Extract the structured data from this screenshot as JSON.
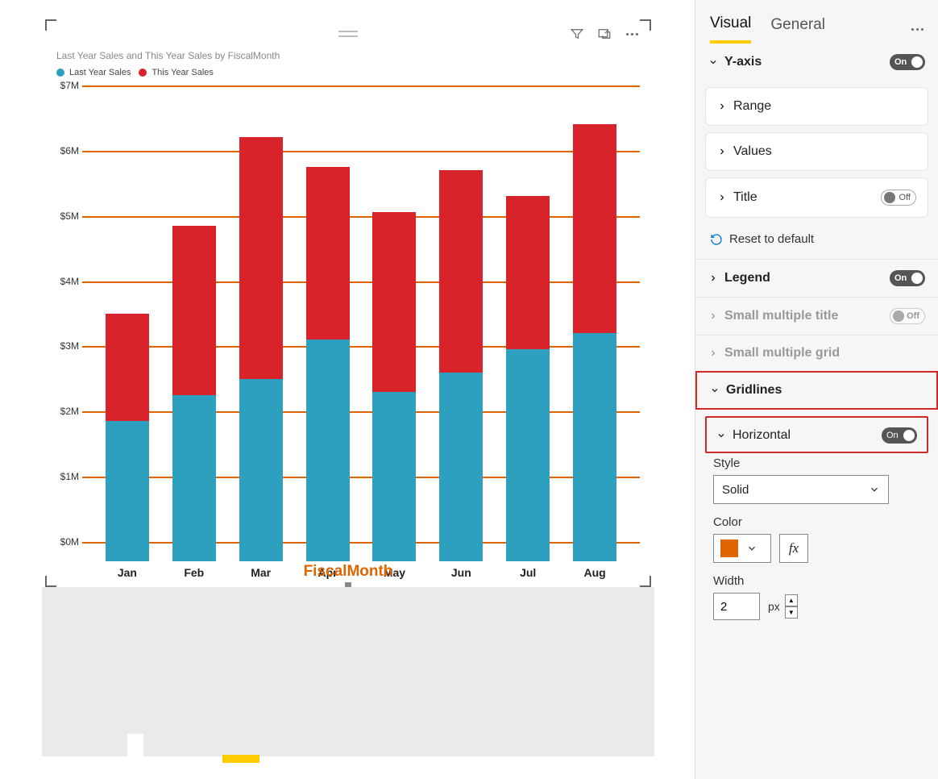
{
  "tabs": {
    "visual": "Visual",
    "general": "General"
  },
  "yaxis": {
    "label": "Y-axis",
    "toggle": "On",
    "range": "Range",
    "values": "Values",
    "title": "Title",
    "title_toggle": "Off",
    "reset": "Reset to default"
  },
  "legend": {
    "label": "Legend",
    "toggle": "On"
  },
  "small_multiple_title": {
    "label": "Small multiple title",
    "toggle": "Off"
  },
  "small_multiple_grid": {
    "label": "Small multiple grid"
  },
  "gridlines": {
    "label": "Gridlines"
  },
  "horizontal": {
    "label": "Horizontal",
    "toggle": "On",
    "style_label": "Style",
    "style_value": "Solid",
    "color_label": "Color",
    "color_value": "#e06500",
    "width_label": "Width",
    "width_value": "2",
    "width_unit": "px"
  },
  "chart": {
    "title": "Last Year Sales and This Year Sales by FiscalMonth",
    "legend_items": [
      {
        "label": "Last Year Sales",
        "color": "#2ea0bf"
      },
      {
        "label": "This Year Sales",
        "color": "#d8232a"
      }
    ],
    "x_axis_title": "FiscalMonth"
  },
  "chart_data": {
    "type": "bar",
    "stacked": true,
    "title": "Last Year Sales and This Year Sales by FiscalMonth",
    "xlabel": "FiscalMonth",
    "ylabel": "",
    "ylim": [
      0,
      7
    ],
    "yticks": [
      "$0M",
      "$1M",
      "$2M",
      "$3M",
      "$4M",
      "$5M",
      "$6M",
      "$7M"
    ],
    "categories": [
      "Jan",
      "Feb",
      "Mar",
      "Apr",
      "May",
      "Jun",
      "Jul",
      "Aug"
    ],
    "series": [
      {
        "name": "Last Year Sales",
        "color": "#2ea0bf",
        "values": [
          2.15,
          2.55,
          2.8,
          3.4,
          2.6,
          2.9,
          3.25,
          3.5
        ]
      },
      {
        "name": "This Year Sales",
        "color": "#d8232a",
        "values": [
          1.65,
          2.6,
          3.7,
          2.65,
          2.75,
          3.1,
          2.35,
          3.2
        ]
      }
    ],
    "grid": {
      "horizontal": true,
      "color": "#e06500",
      "width": 2,
      "style": "solid"
    }
  }
}
